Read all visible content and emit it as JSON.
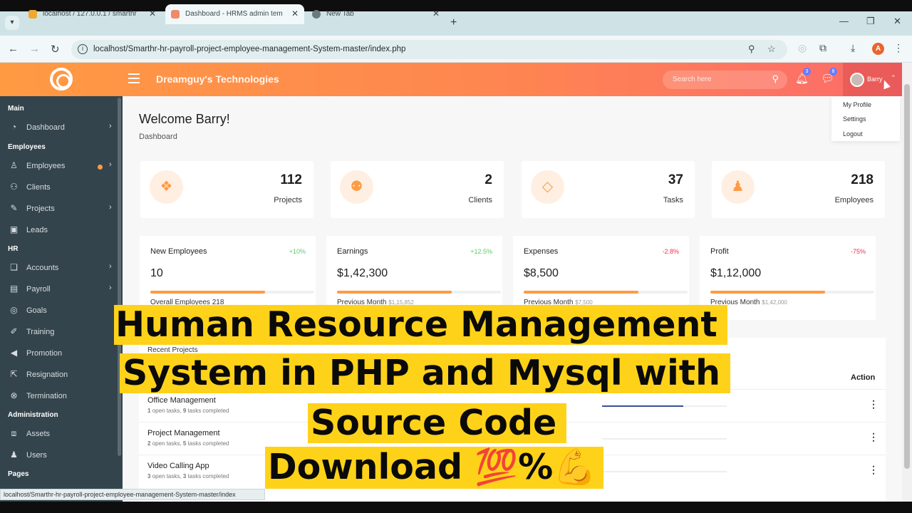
{
  "browser": {
    "tabs": [
      {
        "title": "localhost / 127.0.0.1 / smarthr",
        "active": false
      },
      {
        "title": "Dashboard - HRMS admin tem",
        "active": true
      },
      {
        "title": "New Tab",
        "active": false
      }
    ],
    "url": "localhost/Smarthr-hr-payroll-project-employee-management-System-master/index.php",
    "profile_initial": "A",
    "status_url": "localhost/Smarthr-hr-payroll-project-employee-management-System-master/index"
  },
  "header": {
    "company": "Dreamguy's Technologies",
    "search_placeholder": "Search here",
    "notification_count": "3",
    "message_count": "8",
    "user_name": "Barry"
  },
  "user_dropdown": {
    "items": [
      "My Profile",
      "Settings",
      "Logout"
    ]
  },
  "sidebar": {
    "sections": {
      "main": "Main",
      "employees": "Employees",
      "hr": "HR",
      "administration": "Administration",
      "pages": "Pages"
    },
    "items": [
      {
        "label": "Dashboard",
        "icon": "dashboard-icon"
      },
      {
        "label": "Employees",
        "icon": "user-icon"
      },
      {
        "label": "Clients",
        "icon": "users-icon"
      },
      {
        "label": "Projects",
        "icon": "rocket-icon"
      },
      {
        "label": "Leads",
        "icon": "briefcase-icon"
      },
      {
        "label": "Accounts",
        "icon": "files-icon"
      },
      {
        "label": "Payroll",
        "icon": "money-icon"
      },
      {
        "label": "Goals",
        "icon": "target-icon"
      },
      {
        "label": "Training",
        "icon": "edit-icon"
      },
      {
        "label": "Promotion",
        "icon": "megaphone-icon"
      },
      {
        "label": "Resignation",
        "icon": "external-link-icon"
      },
      {
        "label": "Termination",
        "icon": "times-circle-icon"
      },
      {
        "label": "Assets",
        "icon": "object-group-icon"
      },
      {
        "label": "Users",
        "icon": "user-plus-icon"
      }
    ]
  },
  "main": {
    "welcome": "Welcome Barry!",
    "breadcrumb": "Dashboard",
    "stats": [
      {
        "value": "112",
        "label": "Projects",
        "icon": "cubes-icon"
      },
      {
        "value": "2",
        "label": "Clients",
        "icon": "users-icon"
      },
      {
        "value": "37",
        "label": "Tasks",
        "icon": "diamond-icon"
      },
      {
        "value": "218",
        "label": "Employees",
        "icon": "user-icon"
      }
    ],
    "finance": [
      {
        "title": "New Employees",
        "pct": "+10%",
        "pct_color": "#55ce63",
        "value": "10",
        "progress": 0.7,
        "sub": "Overall Employees 218",
        "sub_muted": ""
      },
      {
        "title": "Earnings",
        "pct": "+12.5%",
        "pct_color": "#55ce63",
        "value": "$1,42,300",
        "progress": 0.7,
        "sub": "Previous Month",
        "sub_muted": "$1,15,852"
      },
      {
        "title": "Expenses",
        "pct": "-2.8%",
        "pct_color": "#f62d51",
        "value": "$8,500",
        "progress": 0.7,
        "sub": "Previous Month",
        "sub_muted": "$7,500"
      },
      {
        "title": "Profit",
        "pct": "-75%",
        "pct_color": "#f62d51",
        "value": "$1,12,000",
        "progress": 0.7,
        "sub": "Previous Month",
        "sub_muted": "$1,42,000"
      }
    ],
    "projects_title": "Recent Projects",
    "action_header": "Action",
    "projects": [
      {
        "name": "Office Management",
        "open": "1",
        "completed": "9",
        "progress": 0.65
      },
      {
        "name": "Project Management",
        "open": "2",
        "completed": "5",
        "progress": 0.0
      },
      {
        "name": "Video Calling App",
        "open": "3",
        "completed": "3",
        "progress": 0.0
      }
    ],
    "open_tasks_label": "open tasks,",
    "tasks_completed_label": "tasks completed"
  },
  "overlay": {
    "line1": "Human Resource Management",
    "line2": "System in PHP and Mysql with",
    "line3": "Source Code",
    "line4": "Download 💯%💪"
  },
  "colors": {
    "accent": "#ff9b44",
    "sidebar": "#34444c",
    "caption_bg": "#ffd21a"
  }
}
